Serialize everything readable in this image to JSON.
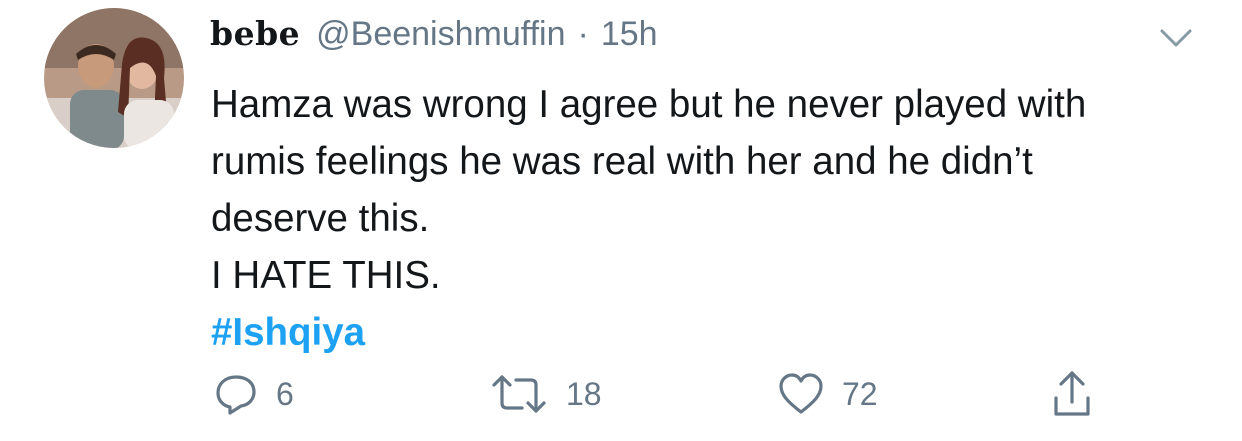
{
  "tweet": {
    "display_name": "bebe",
    "handle": "@Beenishmuffin",
    "separator": "·",
    "timestamp": "15h",
    "lines": [
      "Hamza was wrong I agree but he never played with",
      "rumis feelings he was real with her and he didn’t",
      "deserve this.",
      "I HATE THIS."
    ],
    "hashtag": "#Ishqiya"
  },
  "actions": {
    "reply_count": "6",
    "retweet_count": "18",
    "like_count": "72"
  },
  "icons": {
    "reply": "reply-icon",
    "retweet": "retweet-icon",
    "like": "heart-icon",
    "share": "share-icon",
    "menu": "chevron-down-icon"
  },
  "colors": {
    "text": "#14171a",
    "secondary": "#657786",
    "link": "#1da1f2"
  }
}
